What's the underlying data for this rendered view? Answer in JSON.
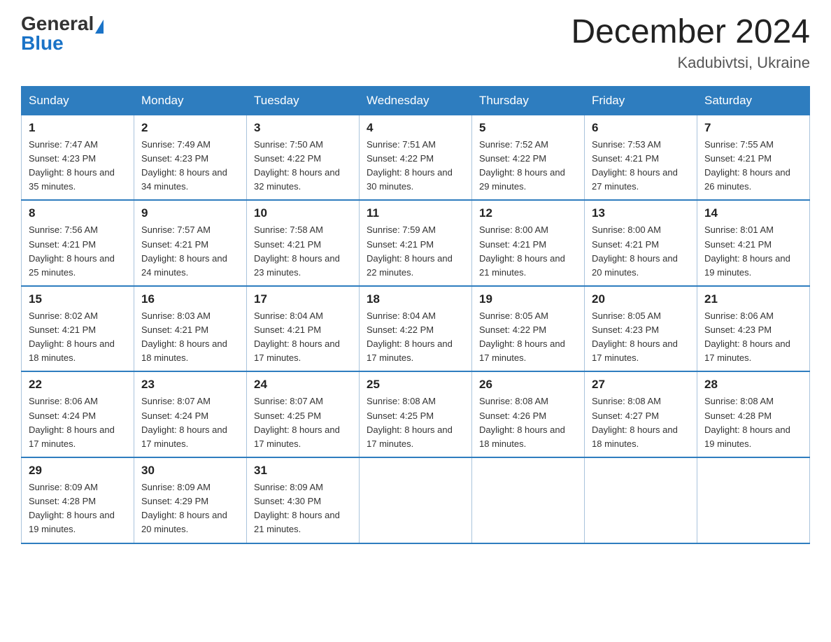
{
  "header": {
    "logo_general": "General",
    "logo_blue": "Blue",
    "month_title": "December 2024",
    "location": "Kadubivtsi, Ukraine"
  },
  "weekdays": [
    "Sunday",
    "Monday",
    "Tuesday",
    "Wednesday",
    "Thursday",
    "Friday",
    "Saturday"
  ],
  "weeks": [
    [
      {
        "day": "1",
        "sunrise": "7:47 AM",
        "sunset": "4:23 PM",
        "daylight": "8 hours and 35 minutes."
      },
      {
        "day": "2",
        "sunrise": "7:49 AM",
        "sunset": "4:23 PM",
        "daylight": "8 hours and 34 minutes."
      },
      {
        "day": "3",
        "sunrise": "7:50 AM",
        "sunset": "4:22 PM",
        "daylight": "8 hours and 32 minutes."
      },
      {
        "day": "4",
        "sunrise": "7:51 AM",
        "sunset": "4:22 PM",
        "daylight": "8 hours and 30 minutes."
      },
      {
        "day": "5",
        "sunrise": "7:52 AM",
        "sunset": "4:22 PM",
        "daylight": "8 hours and 29 minutes."
      },
      {
        "day": "6",
        "sunrise": "7:53 AM",
        "sunset": "4:21 PM",
        "daylight": "8 hours and 27 minutes."
      },
      {
        "day": "7",
        "sunrise": "7:55 AM",
        "sunset": "4:21 PM",
        "daylight": "8 hours and 26 minutes."
      }
    ],
    [
      {
        "day": "8",
        "sunrise": "7:56 AM",
        "sunset": "4:21 PM",
        "daylight": "8 hours and 25 minutes."
      },
      {
        "day": "9",
        "sunrise": "7:57 AM",
        "sunset": "4:21 PM",
        "daylight": "8 hours and 24 minutes."
      },
      {
        "day": "10",
        "sunrise": "7:58 AM",
        "sunset": "4:21 PM",
        "daylight": "8 hours and 23 minutes."
      },
      {
        "day": "11",
        "sunrise": "7:59 AM",
        "sunset": "4:21 PM",
        "daylight": "8 hours and 22 minutes."
      },
      {
        "day": "12",
        "sunrise": "8:00 AM",
        "sunset": "4:21 PM",
        "daylight": "8 hours and 21 minutes."
      },
      {
        "day": "13",
        "sunrise": "8:00 AM",
        "sunset": "4:21 PM",
        "daylight": "8 hours and 20 minutes."
      },
      {
        "day": "14",
        "sunrise": "8:01 AM",
        "sunset": "4:21 PM",
        "daylight": "8 hours and 19 minutes."
      }
    ],
    [
      {
        "day": "15",
        "sunrise": "8:02 AM",
        "sunset": "4:21 PM",
        "daylight": "8 hours and 18 minutes."
      },
      {
        "day": "16",
        "sunrise": "8:03 AM",
        "sunset": "4:21 PM",
        "daylight": "8 hours and 18 minutes."
      },
      {
        "day": "17",
        "sunrise": "8:04 AM",
        "sunset": "4:21 PM",
        "daylight": "8 hours and 17 minutes."
      },
      {
        "day": "18",
        "sunrise": "8:04 AM",
        "sunset": "4:22 PM",
        "daylight": "8 hours and 17 minutes."
      },
      {
        "day": "19",
        "sunrise": "8:05 AM",
        "sunset": "4:22 PM",
        "daylight": "8 hours and 17 minutes."
      },
      {
        "day": "20",
        "sunrise": "8:05 AM",
        "sunset": "4:23 PM",
        "daylight": "8 hours and 17 minutes."
      },
      {
        "day": "21",
        "sunrise": "8:06 AM",
        "sunset": "4:23 PM",
        "daylight": "8 hours and 17 minutes."
      }
    ],
    [
      {
        "day": "22",
        "sunrise": "8:06 AM",
        "sunset": "4:24 PM",
        "daylight": "8 hours and 17 minutes."
      },
      {
        "day": "23",
        "sunrise": "8:07 AM",
        "sunset": "4:24 PM",
        "daylight": "8 hours and 17 minutes."
      },
      {
        "day": "24",
        "sunrise": "8:07 AM",
        "sunset": "4:25 PM",
        "daylight": "8 hours and 17 minutes."
      },
      {
        "day": "25",
        "sunrise": "8:08 AM",
        "sunset": "4:25 PM",
        "daylight": "8 hours and 17 minutes."
      },
      {
        "day": "26",
        "sunrise": "8:08 AM",
        "sunset": "4:26 PM",
        "daylight": "8 hours and 18 minutes."
      },
      {
        "day": "27",
        "sunrise": "8:08 AM",
        "sunset": "4:27 PM",
        "daylight": "8 hours and 18 minutes."
      },
      {
        "day": "28",
        "sunrise": "8:08 AM",
        "sunset": "4:28 PM",
        "daylight": "8 hours and 19 minutes."
      }
    ],
    [
      {
        "day": "29",
        "sunrise": "8:09 AM",
        "sunset": "4:28 PM",
        "daylight": "8 hours and 19 minutes."
      },
      {
        "day": "30",
        "sunrise": "8:09 AM",
        "sunset": "4:29 PM",
        "daylight": "8 hours and 20 minutes."
      },
      {
        "day": "31",
        "sunrise": "8:09 AM",
        "sunset": "4:30 PM",
        "daylight": "8 hours and 21 minutes."
      },
      null,
      null,
      null,
      null
    ]
  ]
}
